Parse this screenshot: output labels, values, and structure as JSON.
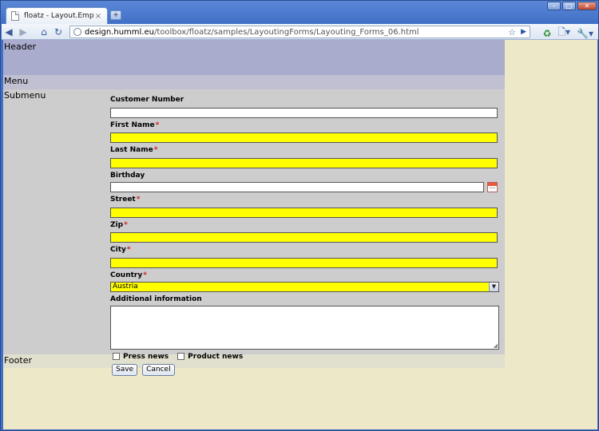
{
  "browser": {
    "tab_title": "floatz - Layout.Empty",
    "tab_close": "×",
    "new_tab": "+",
    "url_host": "design.humml.eu",
    "url_path": "/toolbox/floatz/samples/LayoutingForms/Layouting_Forms_06.html"
  },
  "layout": {
    "header": "Header",
    "menu": "Menu",
    "submenu": "Submenu",
    "footer": "Footer"
  },
  "form": {
    "customer_number": {
      "label": "Customer Number",
      "value": ""
    },
    "first_name": {
      "label": "First Name",
      "required": "*",
      "value": ""
    },
    "last_name": {
      "label": "Last Name",
      "required": "*",
      "value": ""
    },
    "birthday": {
      "label": "Birthday",
      "value": ""
    },
    "street": {
      "label": "Street",
      "required": "*",
      "value": ""
    },
    "zip": {
      "label": "Zip",
      "required": "*",
      "value": ""
    },
    "city": {
      "label": "City",
      "required": "*",
      "value": ""
    },
    "country": {
      "label": "Country",
      "required": "*",
      "selected": "Austria"
    },
    "additional_info": {
      "label": "Additional information",
      "value": ""
    },
    "press_news": "Press news",
    "product_news": "Product news",
    "save": "Save",
    "cancel": "Cancel"
  },
  "colors": {
    "required_field": "#ffff00",
    "header_bg": "#aaaccd",
    "menu_bg": "#c0c0d2",
    "main_bg": "#cdcdcd",
    "viewport_bg": "#ede9c8"
  }
}
